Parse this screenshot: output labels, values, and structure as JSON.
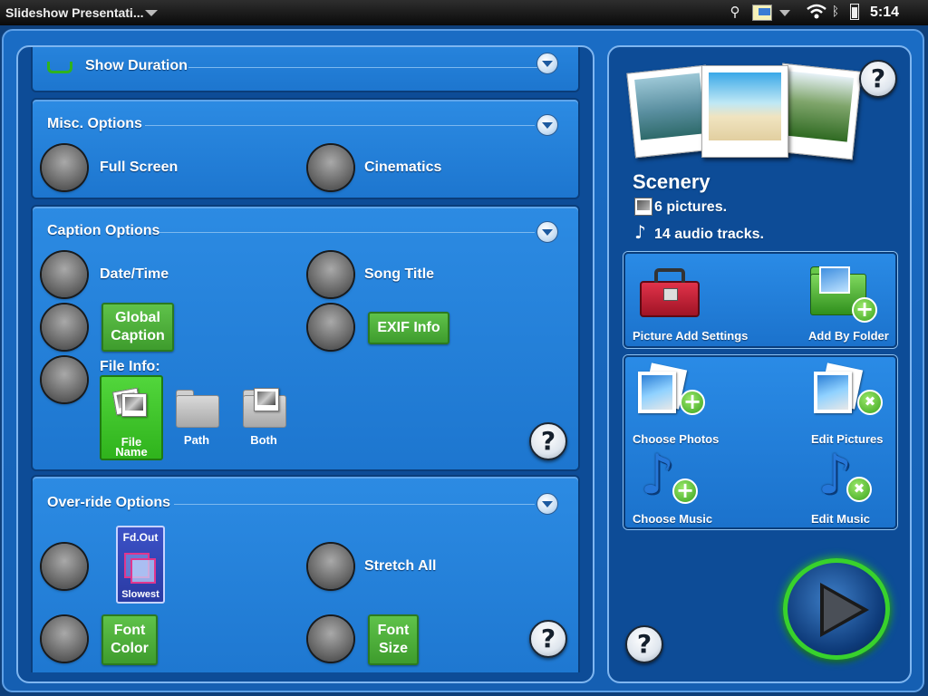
{
  "status_bar": {
    "app_title": "Slideshow Presentati...",
    "time": "5:14"
  },
  "sections": {
    "show_duration": {
      "title": "Show Duration"
    },
    "misc": {
      "title": "Misc. Options",
      "full_screen": "Full Screen",
      "cinematics": "Cinematics"
    },
    "caption": {
      "title": "Caption Options",
      "date_time": "Date/Time",
      "song_title": "Song Title",
      "global_caption_line1": "Global",
      "global_caption_line2": "Caption",
      "exif_info": "EXIF Info",
      "file_info": "File Info:",
      "file_name_line1": "File",
      "file_name_line2": "Name",
      "path": "Path",
      "both": "Both"
    },
    "override": {
      "title": "Over-ride Options",
      "fade_top": "Fd.Out",
      "fade_bottom": "Slowest",
      "stretch_all": "Stretch All",
      "font_color_line1": "Font",
      "font_color_line2": "Color",
      "font_size_line1": "Font",
      "font_size_line2": "Size"
    }
  },
  "album": {
    "name": "Scenery",
    "pictures": "6 pictures.",
    "audio": "14 audio tracks."
  },
  "actions": {
    "picture_add_settings": "Picture Add Settings",
    "add_by_folder": "Add By Folder",
    "choose_photos": "Choose Photos",
    "edit_pictures": "Edit Pictures",
    "choose_music": "Choose Music",
    "edit_music": "Edit Music"
  },
  "help_symbol": "?",
  "colors": {
    "panel_blue": "#1d76cf",
    "green_button": "#3e9c2d",
    "selected_green": "#2fb31c",
    "play_ring": "#38d22c"
  }
}
